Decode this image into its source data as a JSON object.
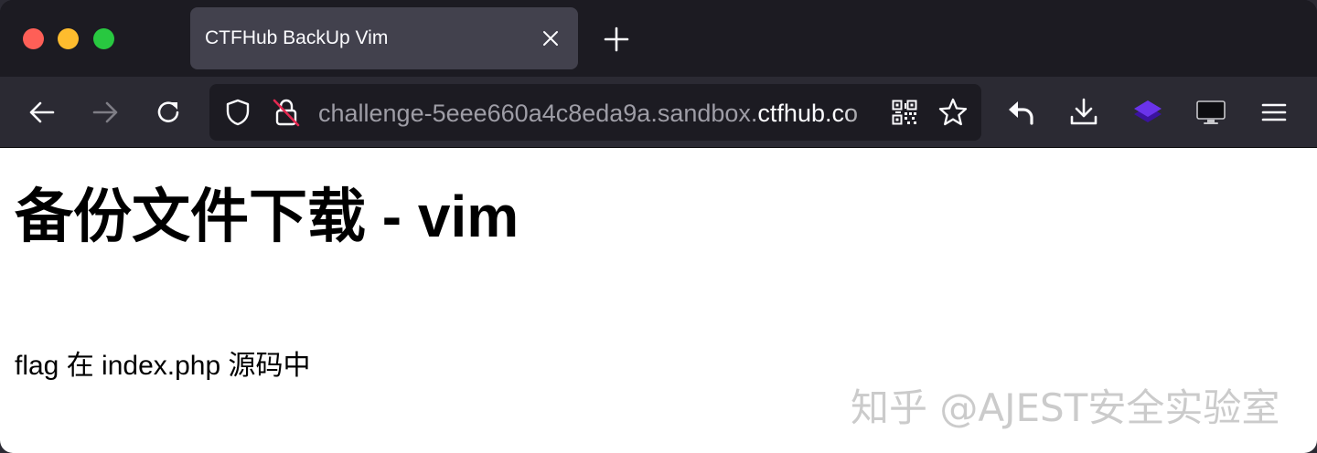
{
  "browser": {
    "tab": {
      "title": "CTFHub BackUp Vim"
    },
    "url": {
      "prefix": "challenge-5eee660a4c8eda9a.sandbox.",
      "domain": "ctfhub.co"
    }
  },
  "icons": {
    "tab_close": "close-icon",
    "new_tab": "plus-icon",
    "back": "arrow-left-icon",
    "forward": "arrow-right-icon",
    "reload": "reload-icon",
    "tracking_protection": "shield-icon",
    "insecure_lock": "lock-slashed-icon",
    "qr": "qr-code-icon",
    "bookmark": "star-icon",
    "share": "reply-arrow-icon",
    "downloads": "download-icon",
    "extension": "purple-layers-icon",
    "device": "monitor-icon",
    "menu": "hamburger-menu-icon"
  },
  "colors": {
    "tab_strip": "#1c1b22",
    "active_tab": "#42414d",
    "toolbar": "#2b2a33",
    "extension_purple": "#5b2bd6"
  },
  "page": {
    "heading": "备份文件下载 - vim",
    "paragraph": "flag 在 index.php 源码中",
    "watermark": "知乎 @AJEST安全实验室"
  }
}
